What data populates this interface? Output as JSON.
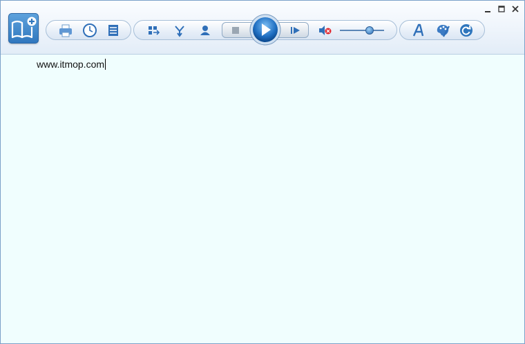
{
  "document": {
    "text": "www.itmop.com"
  },
  "toolbar": {
    "groups": {
      "file": [
        "printer-icon",
        "clock-icon",
        "list-icon"
      ],
      "voice": [
        "queue-icon",
        "merge-icon",
        "person-icon"
      ],
      "playback": [
        "stop-icon",
        "play-icon",
        "next-icon",
        "mute-icon",
        "volume-slider"
      ],
      "display": [
        "font-icon",
        "palette-icon",
        "refresh-icon"
      ]
    },
    "volume_level": 0.72
  },
  "window_controls": [
    "minimize",
    "maximize",
    "close"
  ],
  "colors": {
    "accent": "#2f76bd",
    "content_bg": "#f0fefe",
    "mute_red": "#e0242c"
  }
}
